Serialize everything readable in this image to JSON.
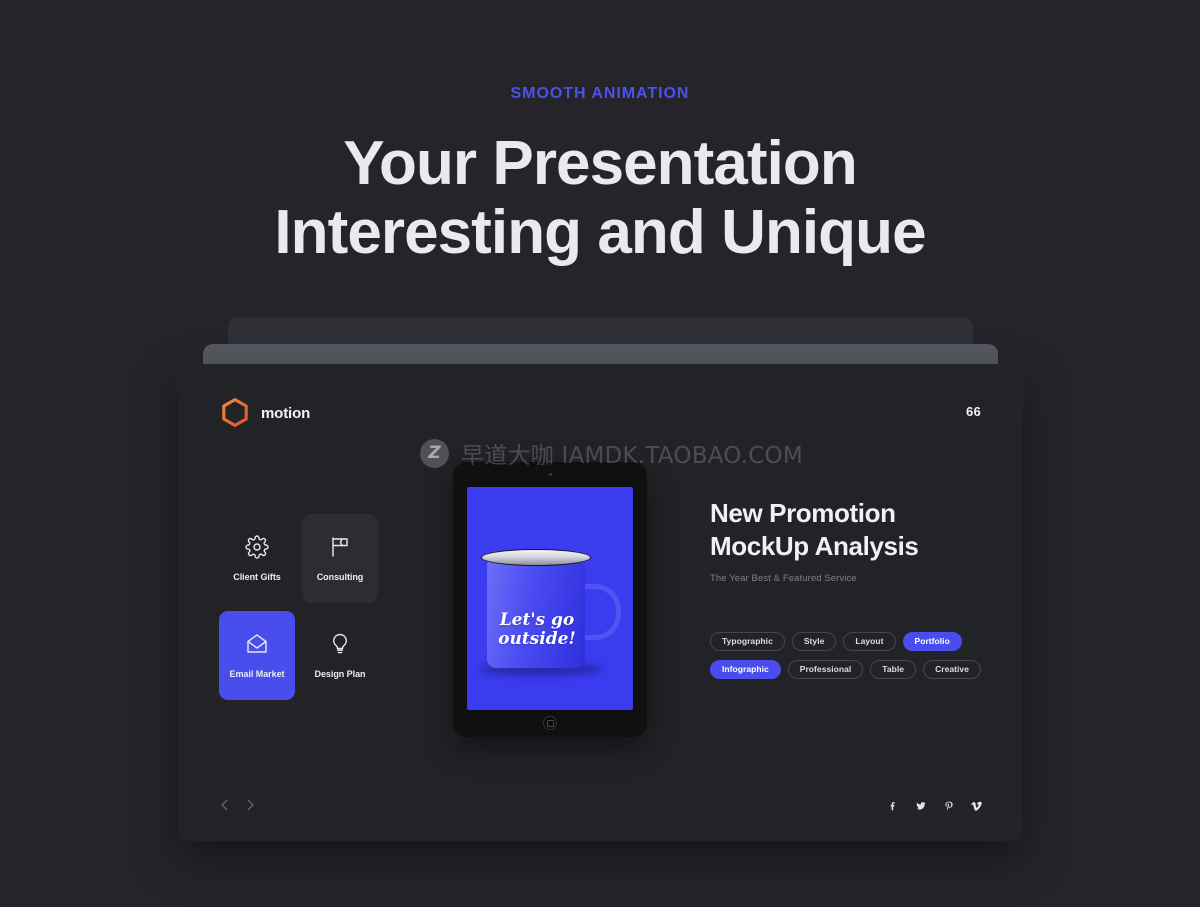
{
  "hero": {
    "eyebrow": "SMOOTH ANIMATION",
    "title_line1": "Your Presentation",
    "title_line2": "Interesting and Unique"
  },
  "colors": {
    "page_bg": "#24242a",
    "card_bg": "#222327",
    "stack_mid": "#565861",
    "stack_back": "#2f3035",
    "accent_blue": "#4a4ded",
    "eyebrow_blue": "#4a53e8",
    "logo_orange": "#e8713a",
    "tile_shade": "#2c2d31",
    "screen_blue": "#3b3cf0"
  },
  "card": {
    "brand": {
      "name": "motion",
      "mark": "hexagon-outline-icon"
    },
    "page_number": "66",
    "tiles": [
      {
        "label": "Client Gifts",
        "icon": "gear-icon",
        "state": "default"
      },
      {
        "label": "Consulting",
        "icon": "flag-icon",
        "state": "shade"
      },
      {
        "label": "Email Market",
        "icon": "envelope-icon",
        "state": "active"
      },
      {
        "label": "Design Plan",
        "icon": "lightbulb-icon",
        "state": "default"
      }
    ],
    "device": {
      "screen_caption_line1": "Let's go",
      "screen_caption_line2": "outside!",
      "camera": "camera-dot",
      "home_button": "home-button"
    },
    "content": {
      "title_line1": "New Promotion",
      "title_line2": "MockUp Analysis",
      "subtitle": "The Year Best & Featured Service",
      "tags_row1": [
        {
          "label": "Typographic",
          "filled": false
        },
        {
          "label": "Style",
          "filled": false
        },
        {
          "label": "Layout",
          "filled": false
        },
        {
          "label": "Portfolio",
          "filled": true
        }
      ],
      "tags_row2": [
        {
          "label": "Infographic",
          "filled": true
        },
        {
          "label": "Professional",
          "filled": false
        },
        {
          "label": "Table",
          "filled": false
        },
        {
          "label": "Creative",
          "filled": false
        }
      ]
    },
    "nav": {
      "prev": "chevron-left-icon",
      "next": "chevron-right-icon"
    },
    "socials": [
      {
        "name": "facebook-icon"
      },
      {
        "name": "twitter-icon"
      },
      {
        "name": "pinterest-icon"
      },
      {
        "name": "vimeo-icon"
      }
    ]
  },
  "watermark": {
    "badge": "Z",
    "text": "早道大咖 IAMDK.TAOBAO.COM"
  }
}
